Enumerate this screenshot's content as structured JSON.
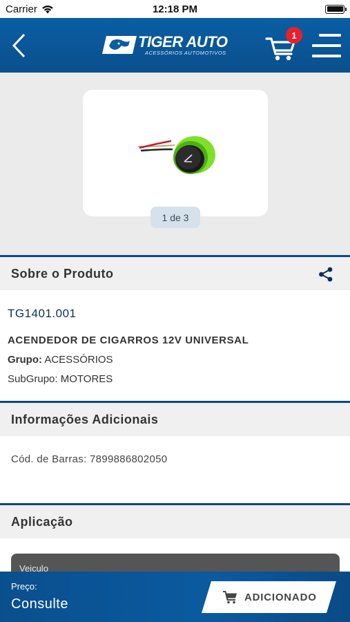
{
  "status_bar": {
    "carrier": "Carrier",
    "time": "12:18 PM"
  },
  "header": {
    "logo_title": "TIGER AUTO",
    "logo_subtitle": "ACESSÓRIOS AUTOMOTIVOS",
    "cart_count": "1"
  },
  "gallery": {
    "pager": "1 de 3"
  },
  "about": {
    "title": "Sobre o Produto",
    "sku": "TG1401.001",
    "name": "ACENDEDOR DE CIGARROS 12V UNIVERSAL",
    "group_label": "Grupo:",
    "group_value": "ACESSÓRIOS",
    "subgroup_label": "SubGrupo:",
    "subgroup_value": "MOTORES"
  },
  "additional": {
    "title": "Informações Adicionais",
    "barcode_label": "Cód. de Barras:",
    "barcode_value": "7899886802050"
  },
  "application": {
    "title": "Aplicação",
    "vehicle_header": "Veiculo"
  },
  "bottom_bar": {
    "price_label": "Preço:",
    "price_value": "Consulte",
    "add_button": "ADICIONADO"
  },
  "colors": {
    "brand_blue": "#0a5ea3",
    "badge_red": "#e8202a",
    "section_border": "#0b4a7e",
    "sku_text": "#0b2d5e"
  }
}
